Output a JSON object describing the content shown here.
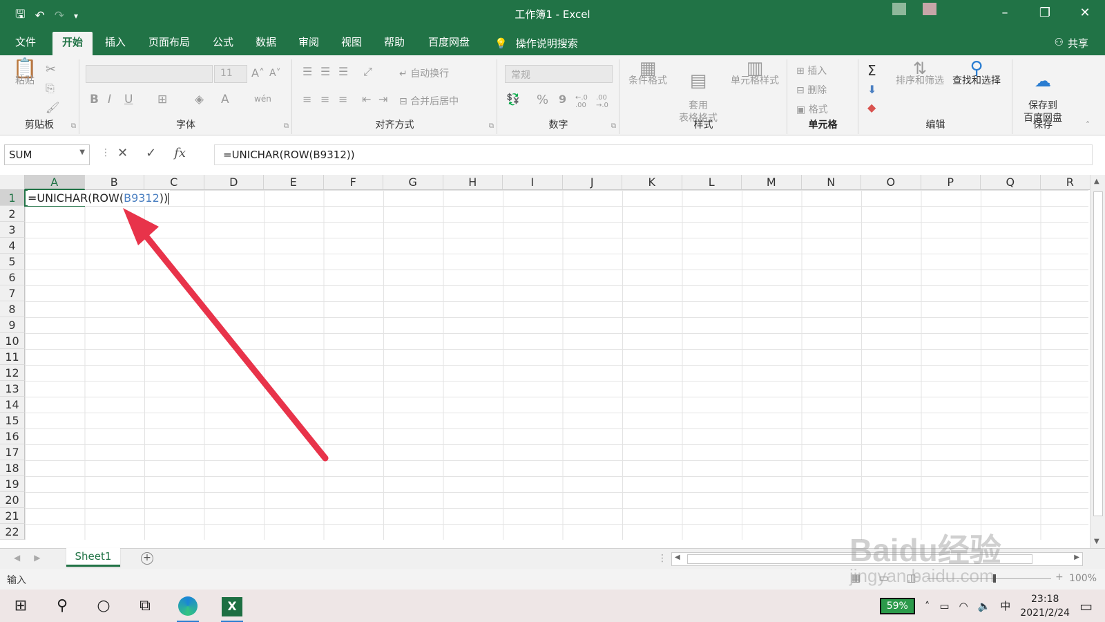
{
  "window": {
    "title": "工作簿1 - Excel",
    "minimize": "–",
    "restore": "❐",
    "close": "✕"
  },
  "quick_access": {
    "save": "🖫",
    "undo": "↶",
    "redo": "↷",
    "customize": "▾"
  },
  "ribbon_tabs": [
    "文件",
    "开始",
    "插入",
    "页面布局",
    "公式",
    "数据",
    "审阅",
    "视图",
    "帮助",
    "百度网盘"
  ],
  "active_tab": "开始",
  "tell_me": "操作说明搜索",
  "share": "共享",
  "ribbon": {
    "clipboard": {
      "label": "剪贴板",
      "paste": "粘贴"
    },
    "font": {
      "label": "字体",
      "font_name": "",
      "font_size": "11",
      "bold": "B",
      "italic": "I",
      "underline": "U",
      "grow": "A˄",
      "shrink": "A˅",
      "font_color": "A",
      "phonetic": "wén"
    },
    "alignment": {
      "label": "对齐方式",
      "wrap_text": "自动换行",
      "merge_center": "合并后居中"
    },
    "number": {
      "label": "数字",
      "format": "常规",
      "percent": "%",
      "comma": "9",
      "inc_decimal": "←.0 .00",
      "dec_decimal": ".00 →.0"
    },
    "styles": {
      "label": "样式",
      "conditional": "条件格式",
      "table_format": "套用\n表格格式",
      "cell_styles": "单元格样式"
    },
    "cells": {
      "label": "单元格",
      "insert": "插入",
      "delete": "删除",
      "format": "格式"
    },
    "editing": {
      "label": "编辑",
      "sort_filter": "排序和筛选",
      "find_select": "查找和选择",
      "autosum": "Σ"
    },
    "save": {
      "label": "保存",
      "save_to_baidu": "保存到\n百度网盘"
    }
  },
  "formula_bar": {
    "name_box": "SUM",
    "cancel": "✕",
    "enter": "✓",
    "fx": "fx",
    "content": "=UNICHAR(ROW(B9312))"
  },
  "columns": [
    "A",
    "B",
    "C",
    "D",
    "E",
    "F",
    "G",
    "H",
    "I",
    "J",
    "K",
    "L",
    "M",
    "N",
    "O",
    "P",
    "Q",
    "R"
  ],
  "rows": [
    "1",
    "2",
    "3",
    "4",
    "5",
    "6",
    "7",
    "8",
    "9",
    "10",
    "11",
    "12",
    "13",
    "14",
    "15",
    "16",
    "17",
    "18",
    "19",
    "20",
    "21",
    "22"
  ],
  "active_cell": {
    "text_prefix": "=UNICHAR(ROW(",
    "text_ref": "B9312",
    "text_suffix": "))"
  },
  "sheets": [
    "Sheet1"
  ],
  "add_sheet": "+",
  "status": {
    "mode": "输入",
    "zoom": "100%",
    "zoom_minus": "–",
    "zoom_plus": "+"
  },
  "taskbar": {
    "battery": "59%",
    "ime": "中",
    "time": "23:18",
    "date": "2021/2/24"
  },
  "watermark": {
    "logo": "Baidu经验",
    "url": "jingyan.baidu.com"
  },
  "colors": {
    "excel_green": "#217346",
    "arrow_red": "#e8334a",
    "ref_blue": "#4a7fc1"
  }
}
